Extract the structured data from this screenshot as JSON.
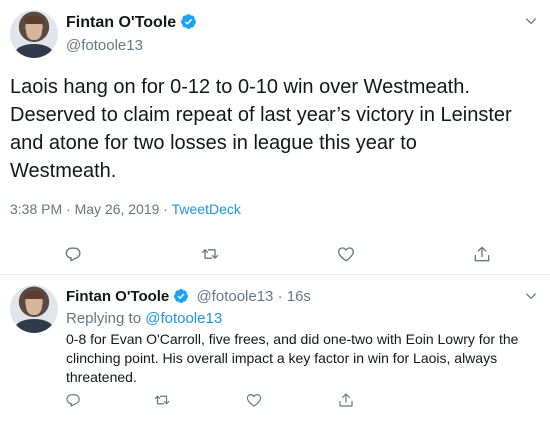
{
  "main_tweet": {
    "author_name": "Fintan O'Toole",
    "author_handle": "@fotoole13",
    "text_lines": [
      "Laois hang on for 0-12 to 0-10 win over Westmeath.",
      "Deserved to claim repeat of last year’s victory in Leinster",
      "and atone for two losses in league this year to",
      "Westmeath."
    ],
    "timestamp": "3:38 PM · May 26, 2019 · ",
    "source": "TweetDeck",
    "icons": [
      "reply-icon",
      "retweet-icon",
      "like-icon",
      "share-icon"
    ]
  },
  "reply_tweet": {
    "author_name": "Fintan O'Toole",
    "author_handle": "@fotoole13",
    "time_ago": "· 16s",
    "replying_prefix": "Replying to ",
    "replying_to": "@fotoole13",
    "text_lines": [
      "0-8 for Evan O'Carroll, five frees, and did one-two with Eoin Lowry for the",
      "clinching point. His overall impact a key factor in win for Laois, always",
      "threatened."
    ]
  },
  "colors": {
    "verified": "#1da1f2",
    "link": "#1b95e0",
    "icon": "#657786"
  }
}
